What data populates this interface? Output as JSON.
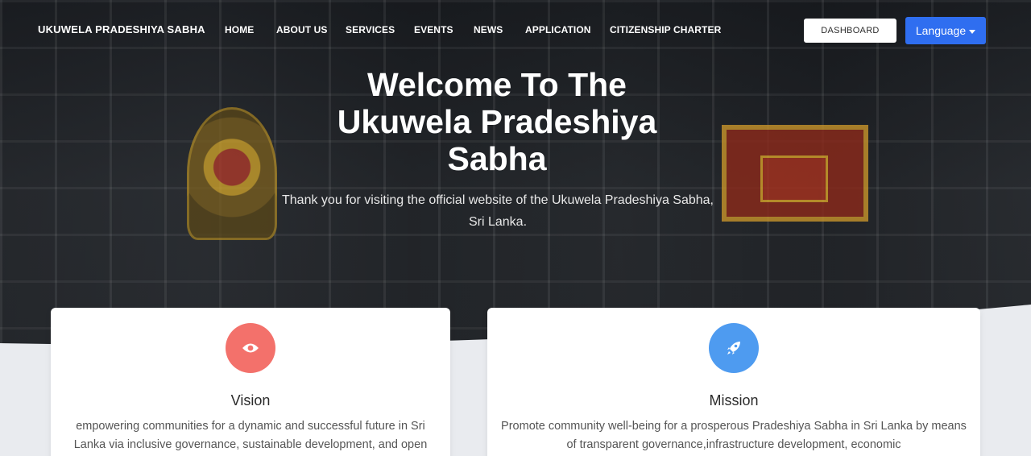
{
  "brand": "UKUWELA PRADESHIYA SABHA",
  "nav": {
    "items": [
      "HOME",
      "ABOUT US",
      "SERVICES",
      "EVENTS",
      "NEWS",
      "APPLICATION",
      "CITIZENSHIP CHARTER"
    ],
    "dashboard_label": "DASHBOARD",
    "language_label": "Language"
  },
  "hero": {
    "title": "Welcome To The Ukuwela Pradeshiya Sabha",
    "subtitle": "Thank you for visiting the official website of the Ukuwela Pradeshiya Sabha, Sri Lanka."
  },
  "cards": [
    {
      "icon": "eye-icon",
      "color": "#f3716b",
      "title": "Vision",
      "text": "empowering communities for a dynamic and successful future in Sri Lanka via inclusive governance, sustainable development, and open"
    },
    {
      "icon": "rocket-icon",
      "color": "#4e9bf0",
      "title": "Mission",
      "text": "Promote community well-being for a prosperous Pradeshiya Sabha in Sri Lanka by means of transparent governance,infrastructure development, economic"
    }
  ]
}
